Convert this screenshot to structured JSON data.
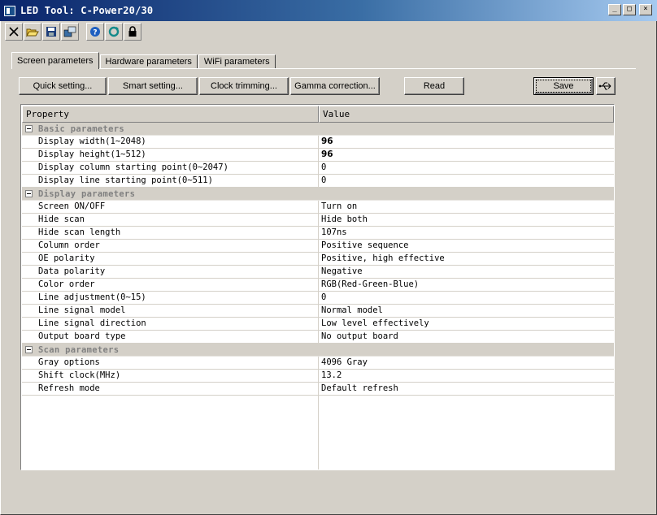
{
  "window": {
    "title": "LED Tool: C-Power20/30"
  },
  "toolbar": {
    "icons": [
      "close-icon",
      "open-folder-icon",
      "save-disk-icon",
      "export-icon",
      "help-icon",
      "refresh-icon",
      "lock-icon"
    ]
  },
  "tabs": [
    "Screen parameters",
    "Hardware parameters",
    "WiFi parameters"
  ],
  "buttons": {
    "quick": "Quick setting...",
    "smart": "Smart setting...",
    "clock": "Clock trimming...",
    "gamma": "Gamma correction...",
    "read": "Read",
    "save": "Save"
  },
  "grid": {
    "headers": [
      "Property",
      "Value"
    ],
    "categories": [
      {
        "name": "Basic parameters",
        "rows": [
          {
            "p": "Display width(1~2048)",
            "v": "96",
            "bold": true
          },
          {
            "p": "Display height(1~512)",
            "v": "96",
            "bold": true
          },
          {
            "p": "Display column starting point(0~2047)",
            "v": "0"
          },
          {
            "p": "Display line starting point(0~511)",
            "v": "0"
          }
        ]
      },
      {
        "name": "Display parameters",
        "rows": [
          {
            "p": "Screen ON/OFF",
            "v": "Turn on"
          },
          {
            "p": "Hide scan",
            "v": "Hide both"
          },
          {
            "p": "Hide scan length",
            "v": "107ns"
          },
          {
            "p": "Column order",
            "v": "Positive sequence"
          },
          {
            "p": "OE polarity",
            "v": "Positive, high effective"
          },
          {
            "p": "Data polarity",
            "v": "Negative"
          },
          {
            "p": "Color order",
            "v": "RGB(Red-Green-Blue)"
          },
          {
            "p": "Line adjustment(0~15)",
            "v": "0"
          },
          {
            "p": "Line signal model",
            "v": "Normal model"
          },
          {
            "p": "Line signal direction",
            "v": "Low level effectively"
          },
          {
            "p": "Output board type",
            "v": "No output board"
          }
        ]
      },
      {
        "name": "Scan parameters",
        "rows": [
          {
            "p": "Gray options",
            "v": "4096 Gray"
          },
          {
            "p": "Shift clock(MHz)",
            "v": "13.2"
          },
          {
            "p": "Refresh mode",
            "v": "Default refresh"
          }
        ]
      }
    ]
  }
}
